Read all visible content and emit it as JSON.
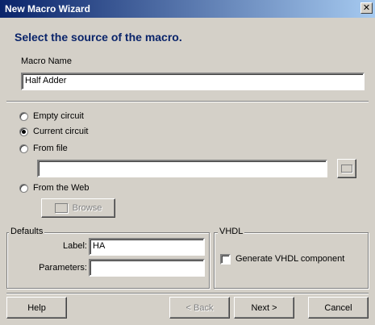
{
  "window": {
    "title": "New Macro Wizard"
  },
  "header": {
    "heading": "Select the source of the macro."
  },
  "macro_name": {
    "label": "Macro Name",
    "value": "Half Adder"
  },
  "source": {
    "options": [
      "Empty circuit",
      "Current circuit",
      "From file",
      "From the Web"
    ],
    "selected": "Current circuit",
    "file_path": "",
    "browse_label": "Browse"
  },
  "defaults": {
    "title": "Defaults",
    "label_label": "Label:",
    "label_value": "HA",
    "parameters_label": "Parameters:",
    "parameters_value": ""
  },
  "vhdl": {
    "title": "VHDL",
    "checkbox_label": "Generate VHDL component"
  },
  "buttons": {
    "help": "Help",
    "back": "< Back",
    "next": "Next >",
    "cancel": "Cancel"
  }
}
